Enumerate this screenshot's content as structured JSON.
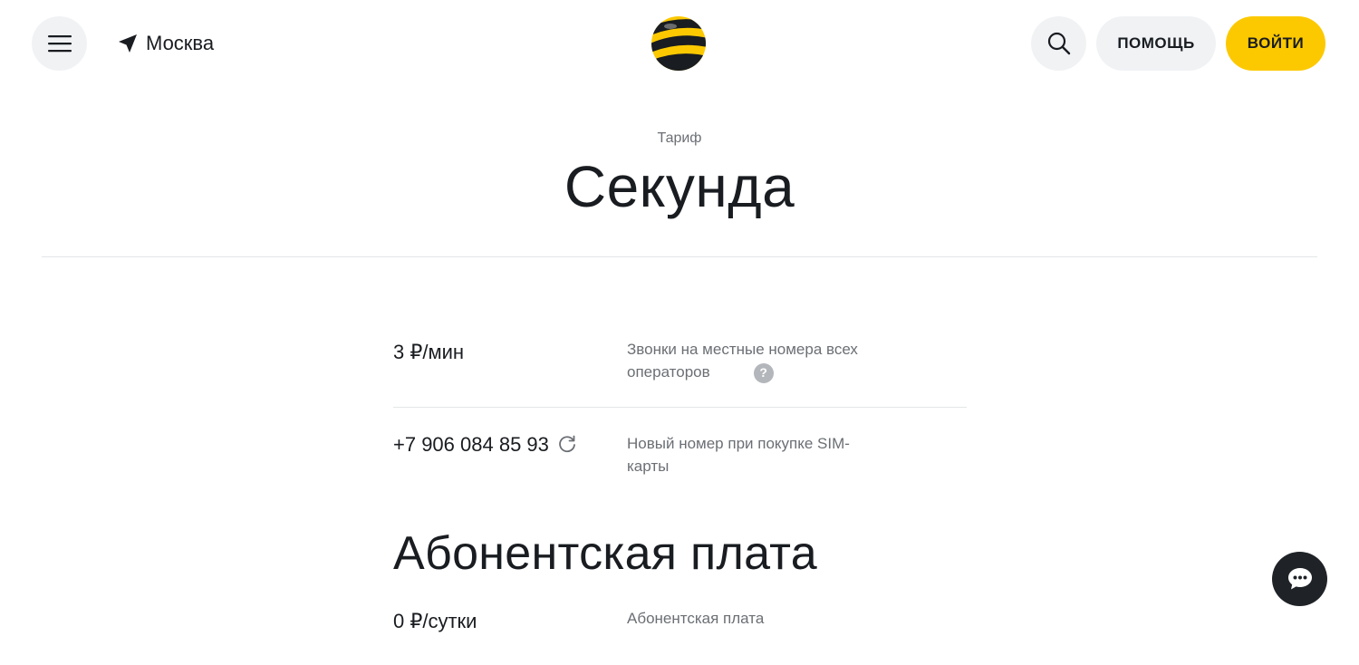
{
  "header": {
    "city": "Москва",
    "help_label": "ПОМОЩЬ",
    "login_label": "ВОЙТИ"
  },
  "tariff": {
    "eyebrow": "Тариф",
    "name": "Секунда"
  },
  "rows": [
    {
      "value": "3 ₽/мин",
      "description": "Звонки на местные номера всех операторов"
    },
    {
      "value": "+7 906 084 85 93",
      "description": "Новый номер при покупке SIM-карты"
    }
  ],
  "subscription": {
    "title": "Абонентская плата",
    "value": "0 ₽/сутки",
    "description": "Абонентская плата"
  },
  "icons": {
    "menu": "menu-icon",
    "location": "location-arrow-icon",
    "logo": "beeline-logo",
    "search": "search-icon",
    "hint": "question-icon",
    "hint_glyph": "?",
    "refresh": "refresh-icon",
    "chat": "chat-icon"
  },
  "colors": {
    "accent": "#fcc900",
    "surface": "#f0f2f4",
    "text": "#191c20",
    "muted": "#6b6f74",
    "chat": "#1f2327"
  }
}
